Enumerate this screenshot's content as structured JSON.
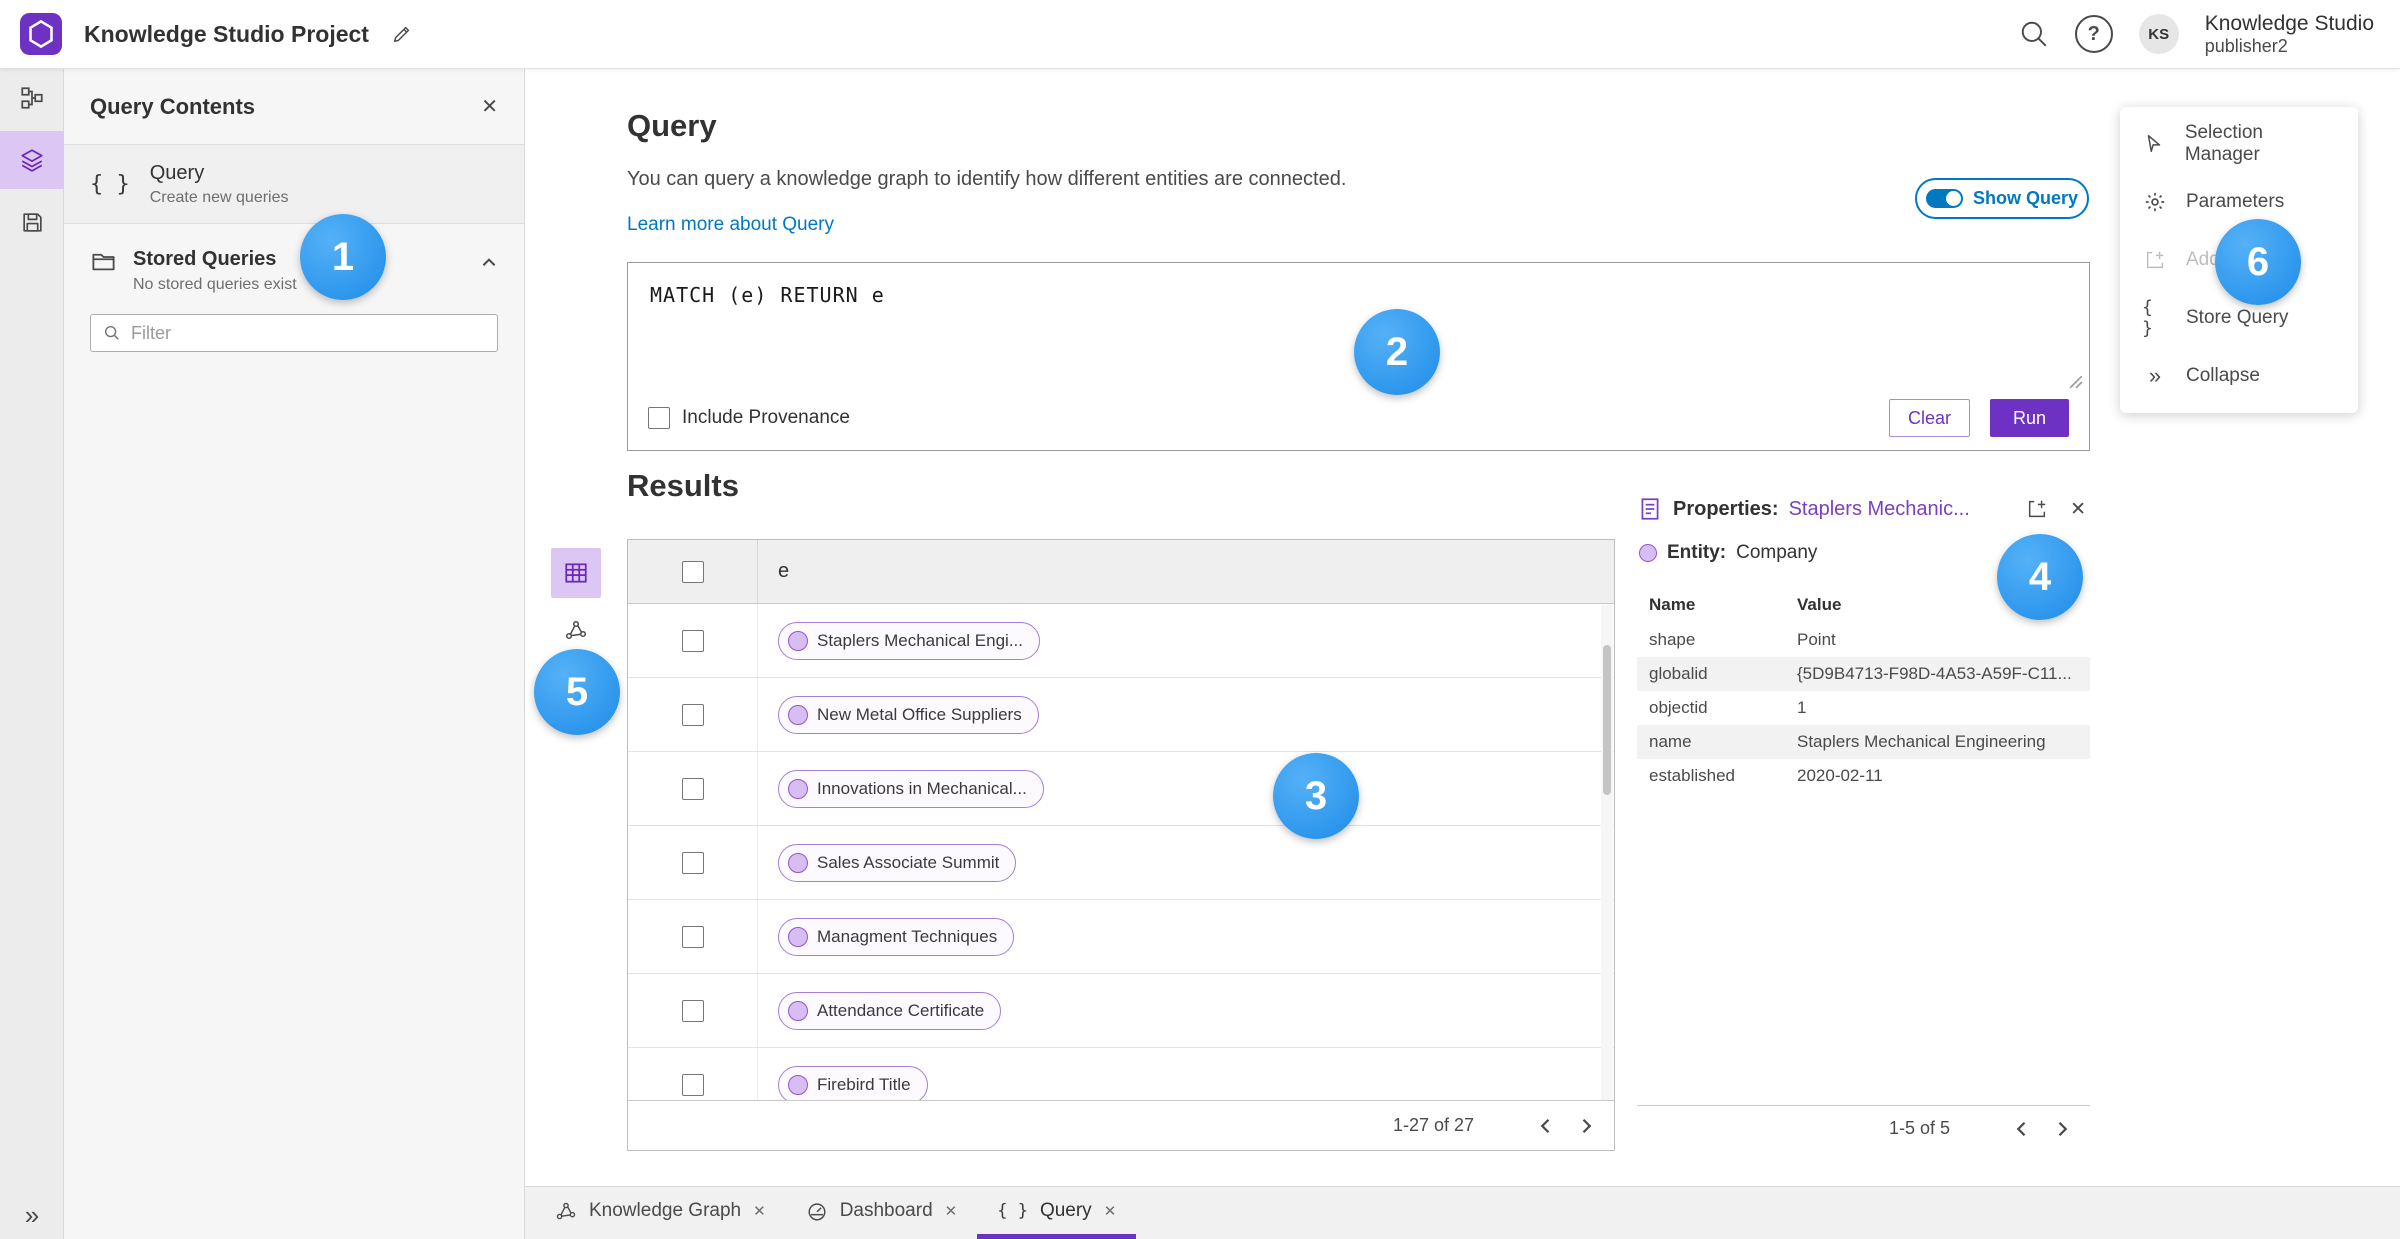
{
  "colors": {
    "accent_purple": "#6d32c4",
    "link_blue": "#0079c1",
    "callout_blue": "#2f9ff2"
  },
  "icons": {
    "help": "?",
    "braces": "{ }",
    "collapse": "»",
    "close": "✕"
  },
  "header": {
    "title": "Knowledge Studio Project",
    "user_initials": "KS",
    "user_name": "Knowledge Studio",
    "user_role": "publisher2"
  },
  "query_contents": {
    "title": "Query Contents",
    "query_label": "Query",
    "query_sublabel": "Create new queries",
    "stored_label": "Stored Queries",
    "stored_empty": "No stored queries exist",
    "filter_placeholder": "Filter"
  },
  "query": {
    "heading": "Query",
    "description": "You can query a knowledge graph to identify how different entities are connected.",
    "learn_more": "Learn more about Query",
    "show_query": "Show Query",
    "code": "MATCH (e) RETURN e",
    "include_provenance": "Include Provenance",
    "clear": "Clear",
    "run": "Run"
  },
  "results": {
    "heading": "Results",
    "column": "e",
    "rows": [
      "Staplers Mechanical Engi...",
      "New Metal Office Suppliers",
      "Innovations in Mechanical...",
      "Sales Associate Summit",
      "Managment Techniques",
      "Attendance Certificate",
      "Firebird Title"
    ],
    "count": "1-27 of 27"
  },
  "properties": {
    "label": "Properties:",
    "entity_title": "Staplers Mechanic...",
    "entity_label": "Entity:",
    "entity_type": "Company",
    "col_name": "Name",
    "col_value": "Value",
    "rows": [
      {
        "name": "shape",
        "value": "Point"
      },
      {
        "name": "globalid",
        "value": "{5D9B4713-F98D-4A53-A59F-C11..."
      },
      {
        "name": "objectid",
        "value": "1"
      },
      {
        "name": "name",
        "value": "Staplers Mechanical Engineering"
      },
      {
        "name": "established",
        "value": "2020-02-11"
      }
    ],
    "count": "1-5 of 5"
  },
  "right_menu": {
    "items": [
      {
        "label": "Selection Manager"
      },
      {
        "label": "Parameters"
      },
      {
        "label": "Add"
      },
      {
        "label": "Store Query"
      },
      {
        "label": "Collapse"
      }
    ]
  },
  "tabs": [
    {
      "label": "Knowledge Graph"
    },
    {
      "label": "Dashboard"
    },
    {
      "label": "Query"
    }
  ],
  "callouts": [
    "1",
    "2",
    "3",
    "4",
    "5",
    "6"
  ]
}
